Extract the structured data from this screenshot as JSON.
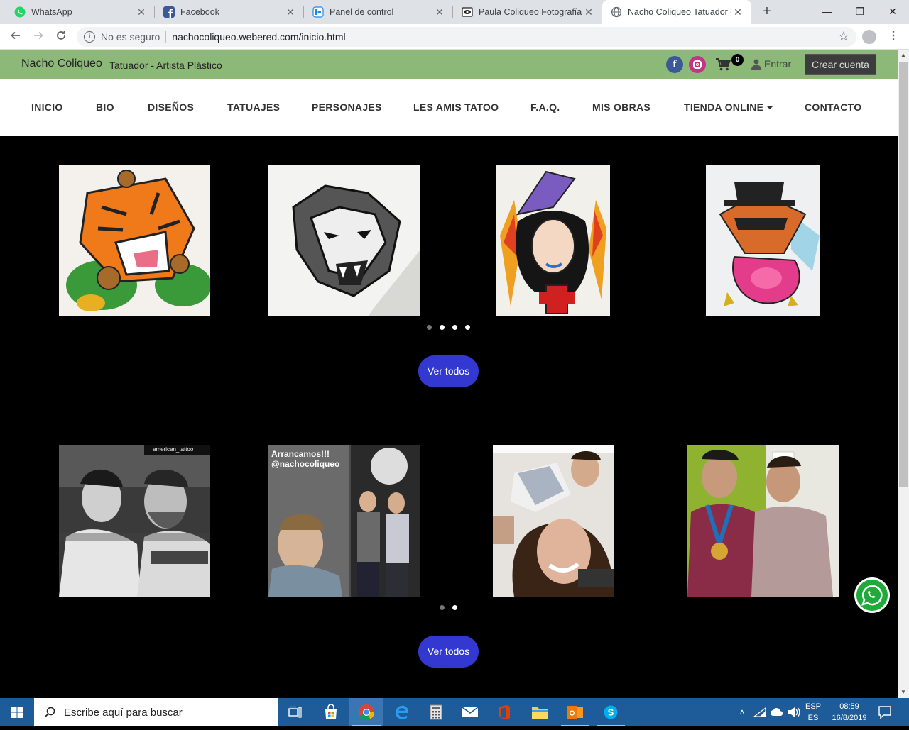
{
  "browser": {
    "tabs": [
      {
        "title": "WhatsApp",
        "icon": "whatsapp-icon"
      },
      {
        "title": "Facebook",
        "icon": "facebook-icon"
      },
      {
        "title": "Panel de control",
        "icon": "webered-icon"
      },
      {
        "title": "Paula Coliqueo Fotografía",
        "icon": "eye-icon"
      },
      {
        "title": "Nacho Coliqueo Tatuador -",
        "icon": "globe-icon"
      }
    ],
    "security_label": "No es seguro",
    "url": "nachocoliqueo.webered.com/inicio.html"
  },
  "site": {
    "brand": "Nacho Coliqueo",
    "tagline": "Tatuador - Artista Plástico",
    "cart_count": "0",
    "login_label": "Entrar",
    "signup_label": "Crear cuenta",
    "nav": [
      "INICIO",
      "BIO",
      "DISEÑOS",
      "TATUAJES",
      "PERSONAJES",
      "LES AMIS TATOO",
      "F.A.Q.",
      "MIS OBRAS",
      "TIENDA ONLINE",
      "CONTACTO"
    ]
  },
  "gallery1": {
    "images": [
      {
        "name": "tiger-design-image",
        "alt": "tiger"
      },
      {
        "name": "wolf-design-image",
        "alt": "wolf"
      },
      {
        "name": "woman-design-image",
        "alt": "woman"
      },
      {
        "name": "fox-design-image",
        "alt": "fox"
      }
    ],
    "dots_active": 0,
    "dots_count": 4,
    "button_label": "Ver todos"
  },
  "gallery2": {
    "images": [
      {
        "name": "photo-friends-bw-image",
        "overlay": "american_tattoo"
      },
      {
        "name": "photo-collage-image",
        "overlay": "Arrancamos!!! @nachocoliqueo"
      },
      {
        "name": "photo-selfie-image",
        "overlay": ""
      },
      {
        "name": "photo-medal-image",
        "overlay": ""
      }
    ],
    "dots_active": 0,
    "dots_count": 2,
    "button_label": "Ver todos"
  },
  "taskbar": {
    "search_placeholder": "Escribe aquí para buscar",
    "lang_top": "ESP",
    "lang_bottom": "ES",
    "time": "08:59",
    "date": "16/8/2019"
  },
  "colors": {
    "topstrip": "#8cb878",
    "button": "#3238d0",
    "whatsapp": "#1faa3a",
    "taskbar": "#1e5c99"
  }
}
